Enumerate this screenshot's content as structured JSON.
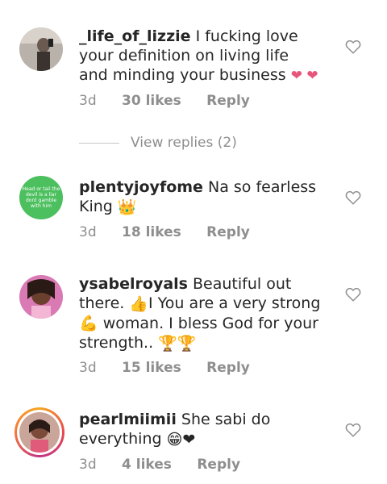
{
  "comments": [
    {
      "username": "_life_of_lizzie",
      "text": " I fucking love your definition on living life and minding your business ",
      "emoji": "❤ ❤",
      "time": "3d",
      "likes": "30 likes",
      "reply": "Reply",
      "avatar_icon": "profile-photo"
    },
    {
      "username": "plentyjoyfome",
      "text": " Na so fearless King ",
      "emoji": "👑",
      "time": "3d",
      "likes": "18 likes",
      "reply": "Reply",
      "avatar_text": "Head or tail the devil is a liar dont gamble with him"
    },
    {
      "username": "ysabelroyals",
      "text": " Beautiful out there. ",
      "text2": "I You are a very  strong ",
      "text3": " woman. I bless God for your strength.. ",
      "emoji_a": "👍",
      "emoji_b": "💪",
      "emoji_c": "🏆🏆",
      "time": "3d",
      "likes": "15 likes",
      "reply": "Reply",
      "avatar_icon": "profile-photo"
    },
    {
      "username": "pearlmiimii",
      "text": " She sabi do everything ",
      "emoji": "😁❤",
      "time": "3d",
      "likes": "4 likes",
      "reply": "Reply",
      "avatar_icon": "profile-photo-story-ring"
    }
  ],
  "view_replies": "View replies (2)",
  "colors": {
    "text": "#262626",
    "meta": "#8e8e8e",
    "heart": "#e8557a",
    "avatar_green": "#4cbf5e"
  }
}
